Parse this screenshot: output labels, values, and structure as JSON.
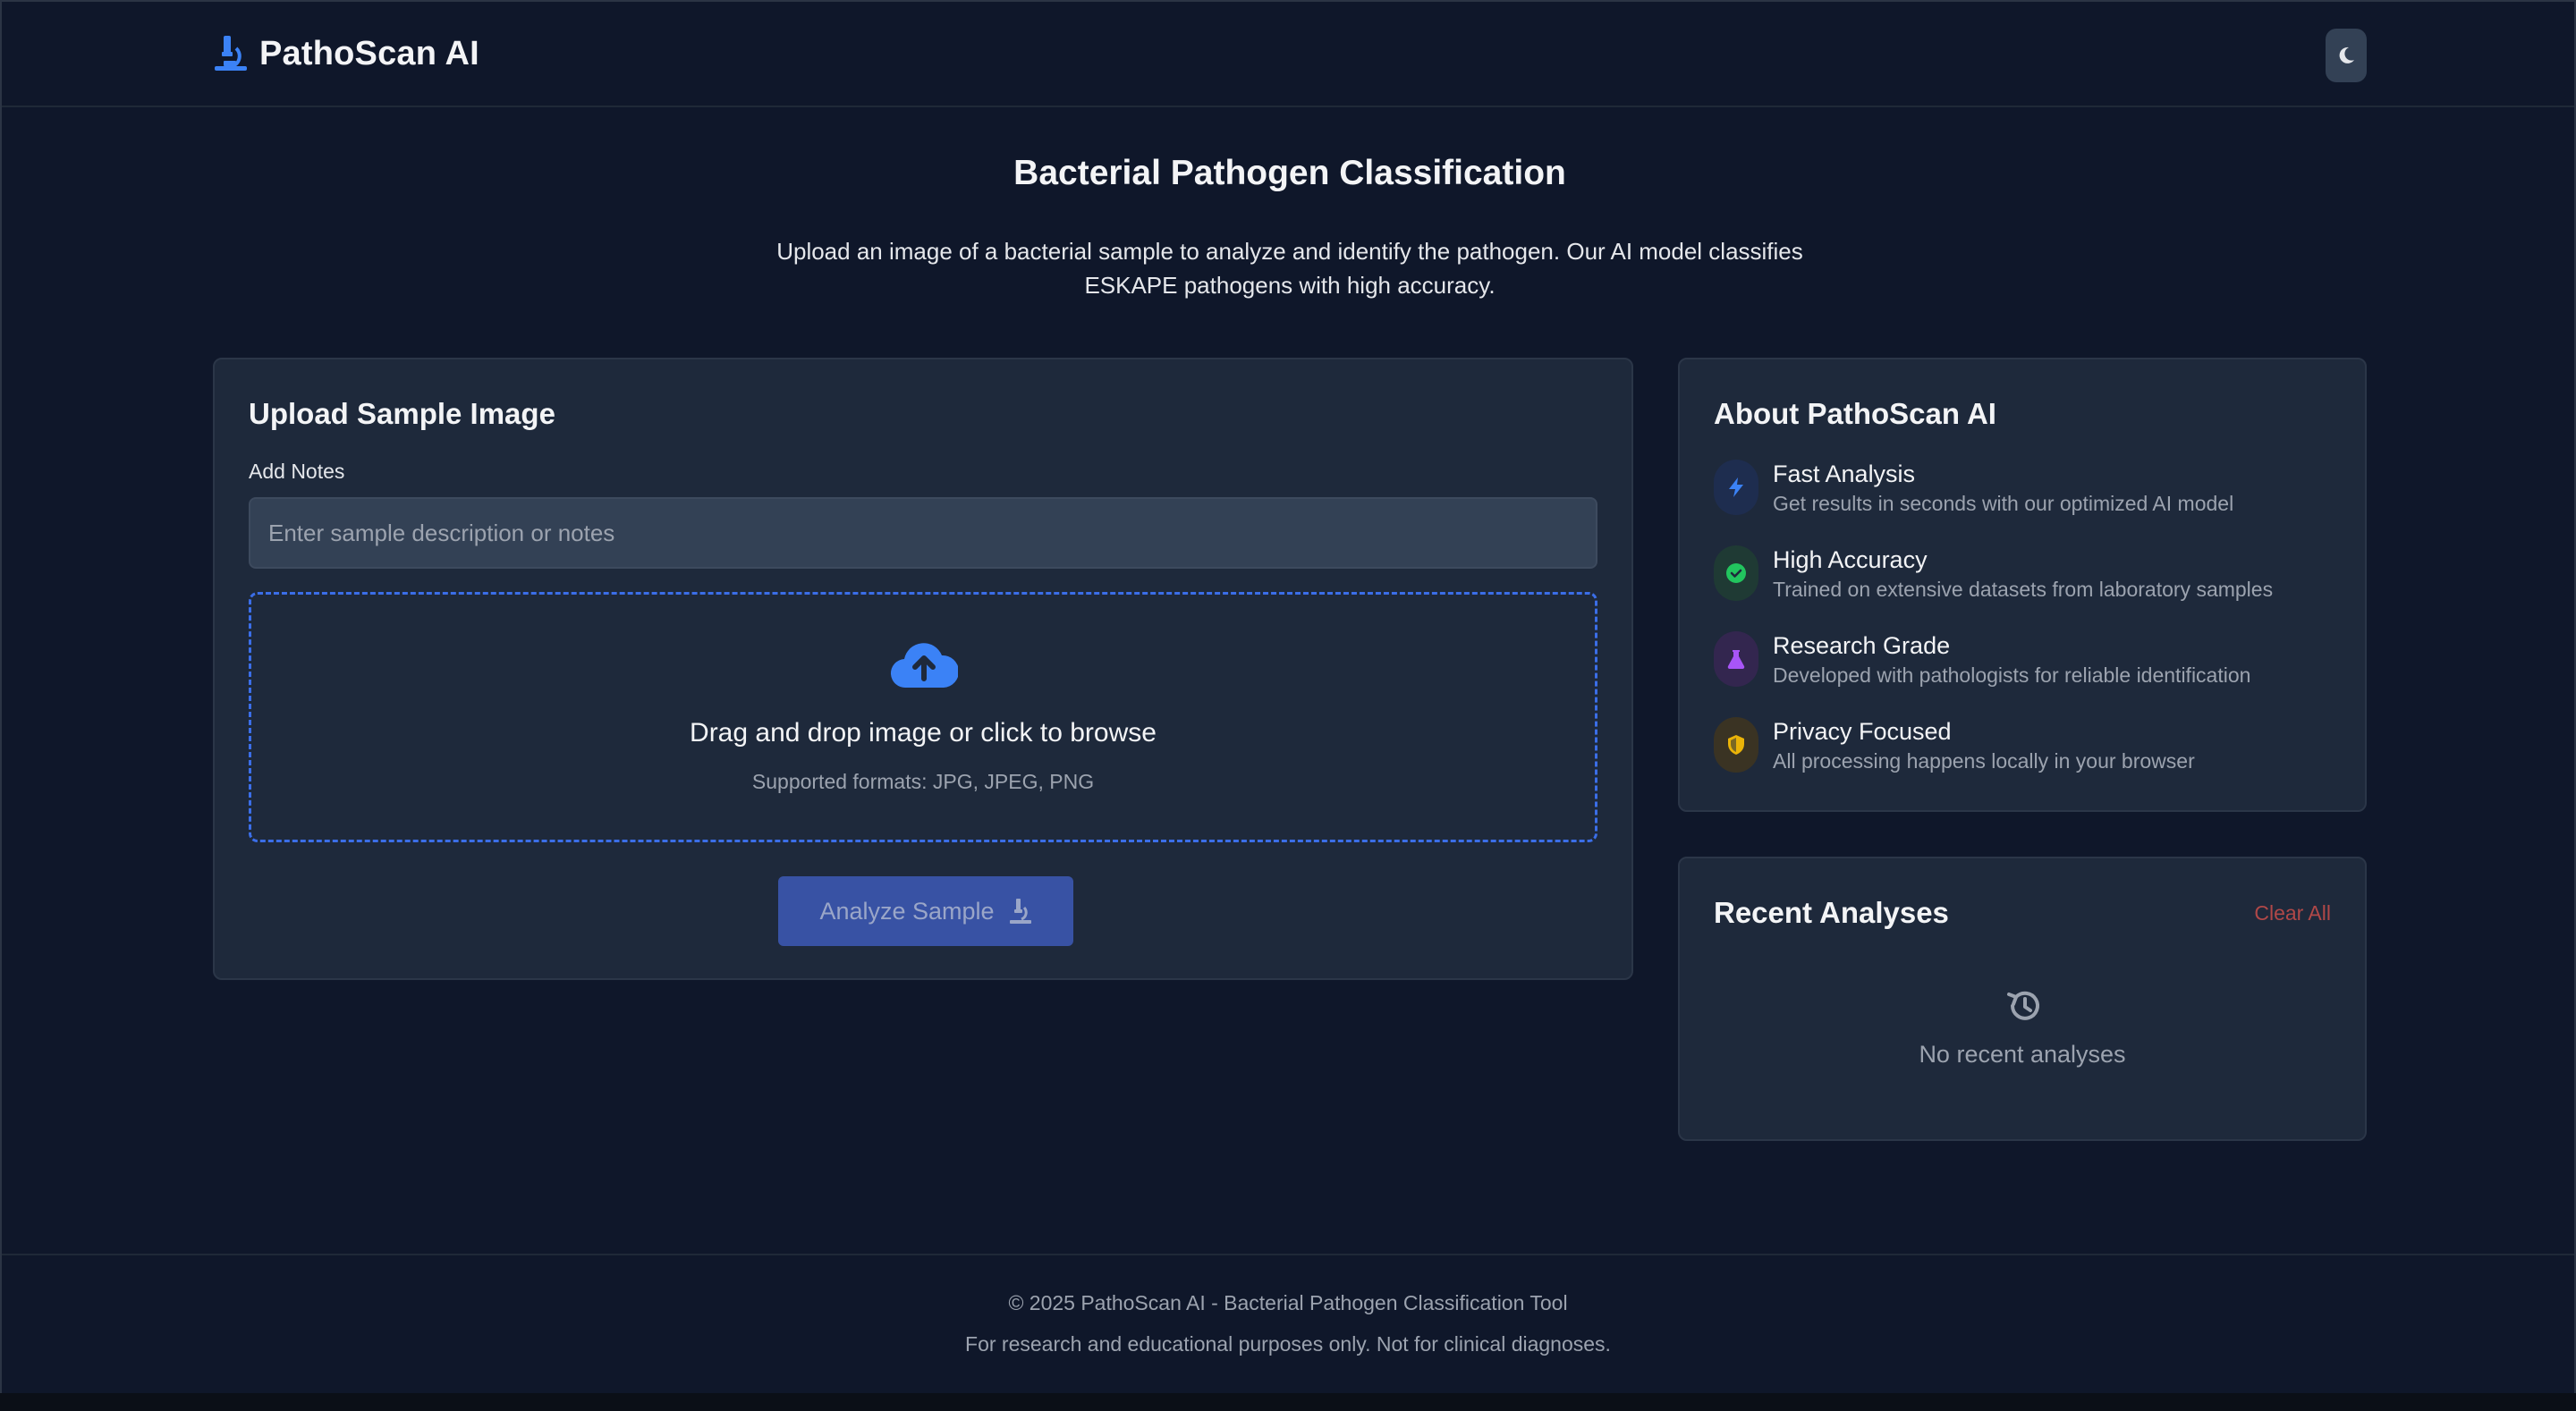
{
  "header": {
    "brand": "PathoScan AI",
    "brand_icon": "microscope-icon",
    "theme_toggle_icon": "moon-icon"
  },
  "hero": {
    "title": "Bacterial Pathogen Classification",
    "description": "Upload an image of a bacterial sample to analyze and identify the pathogen. Our AI model classifies ESKAPE pathogens with high accuracy."
  },
  "upload": {
    "title": "Upload Sample Image",
    "notes_label": "Add Notes",
    "notes_placeholder": "Enter sample description or notes",
    "notes_value": "",
    "dropzone_title": "Drag and drop image or click to browse",
    "dropzone_formats": "Supported formats: JPG, JPEG, PNG",
    "analyze_label": "Analyze Sample"
  },
  "about": {
    "title": "About PathoScan AI",
    "features": [
      {
        "title": "Fast Analysis",
        "desc": "Get results in seconds with our optimized AI model",
        "icon": "bolt-icon",
        "color": "#3b82f6"
      },
      {
        "title": "High Accuracy",
        "desc": "Trained on extensive datasets from laboratory samples",
        "icon": "check-circle-icon",
        "color": "#22c55e"
      },
      {
        "title": "Research Grade",
        "desc": "Developed with pathologists for reliable identification",
        "icon": "flask-icon",
        "color": "#a855f7"
      },
      {
        "title": "Privacy Focused",
        "desc": "All processing happens locally in your browser",
        "icon": "shield-icon",
        "color": "#eab308"
      }
    ]
  },
  "recent": {
    "title": "Recent Analyses",
    "clear_label": "Clear All",
    "empty_text": "No recent analyses"
  },
  "footer": {
    "copyright": "© 2025 PathoScan AI - Bacterial Pathogen Classification Tool",
    "disclaimer": "For research and educational purposes only. Not for clinical diagnoses."
  },
  "colors": {
    "background": "#0f172a",
    "card": "#1e293b",
    "accent": "#3b82f6",
    "danger": "#b04848"
  }
}
